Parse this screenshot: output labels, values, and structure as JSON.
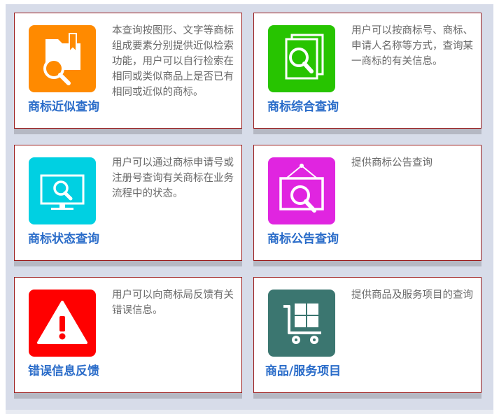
{
  "colors": {
    "card_border": "#9b1b1b",
    "title": "#2a6cc9",
    "description": "#6a6a6a",
    "background": "#d7dce9"
  },
  "cards": [
    {
      "title": "商标近似查询",
      "description": "本查询按图形、文字等商标组成要素分别提供近似检索功能，用户可以自行检索在相同或类似商品上是否已有相同或近似的商标。",
      "icon": "folder-search-icon",
      "color": "#ff8a00"
    },
    {
      "title": "商标综合查询",
      "description": "用户可以按商标号、商标、申请人名称等方式，查询某一商标的有关信息。",
      "icon": "documents-search-icon",
      "color": "#27c400"
    },
    {
      "title": "商标状态查询",
      "description": "用户可以通过商标申请号或注册号查询有关商标在业务流程中的状态。",
      "icon": "monitor-search-icon",
      "color": "#00d0e2"
    },
    {
      "title": "商标公告查询",
      "description": "提供商标公告查询",
      "icon": "frame-search-icon",
      "color": "#e025e0"
    },
    {
      "title": "错误信息反馈",
      "description": "用户可以向商标局反馈有关错误信息。",
      "icon": "warning-icon",
      "color": "#ff0000"
    },
    {
      "title": "商品/服务项目",
      "description": "提供商品及服务项目的查询",
      "icon": "cart-icon",
      "color": "#3b7670"
    }
  ]
}
